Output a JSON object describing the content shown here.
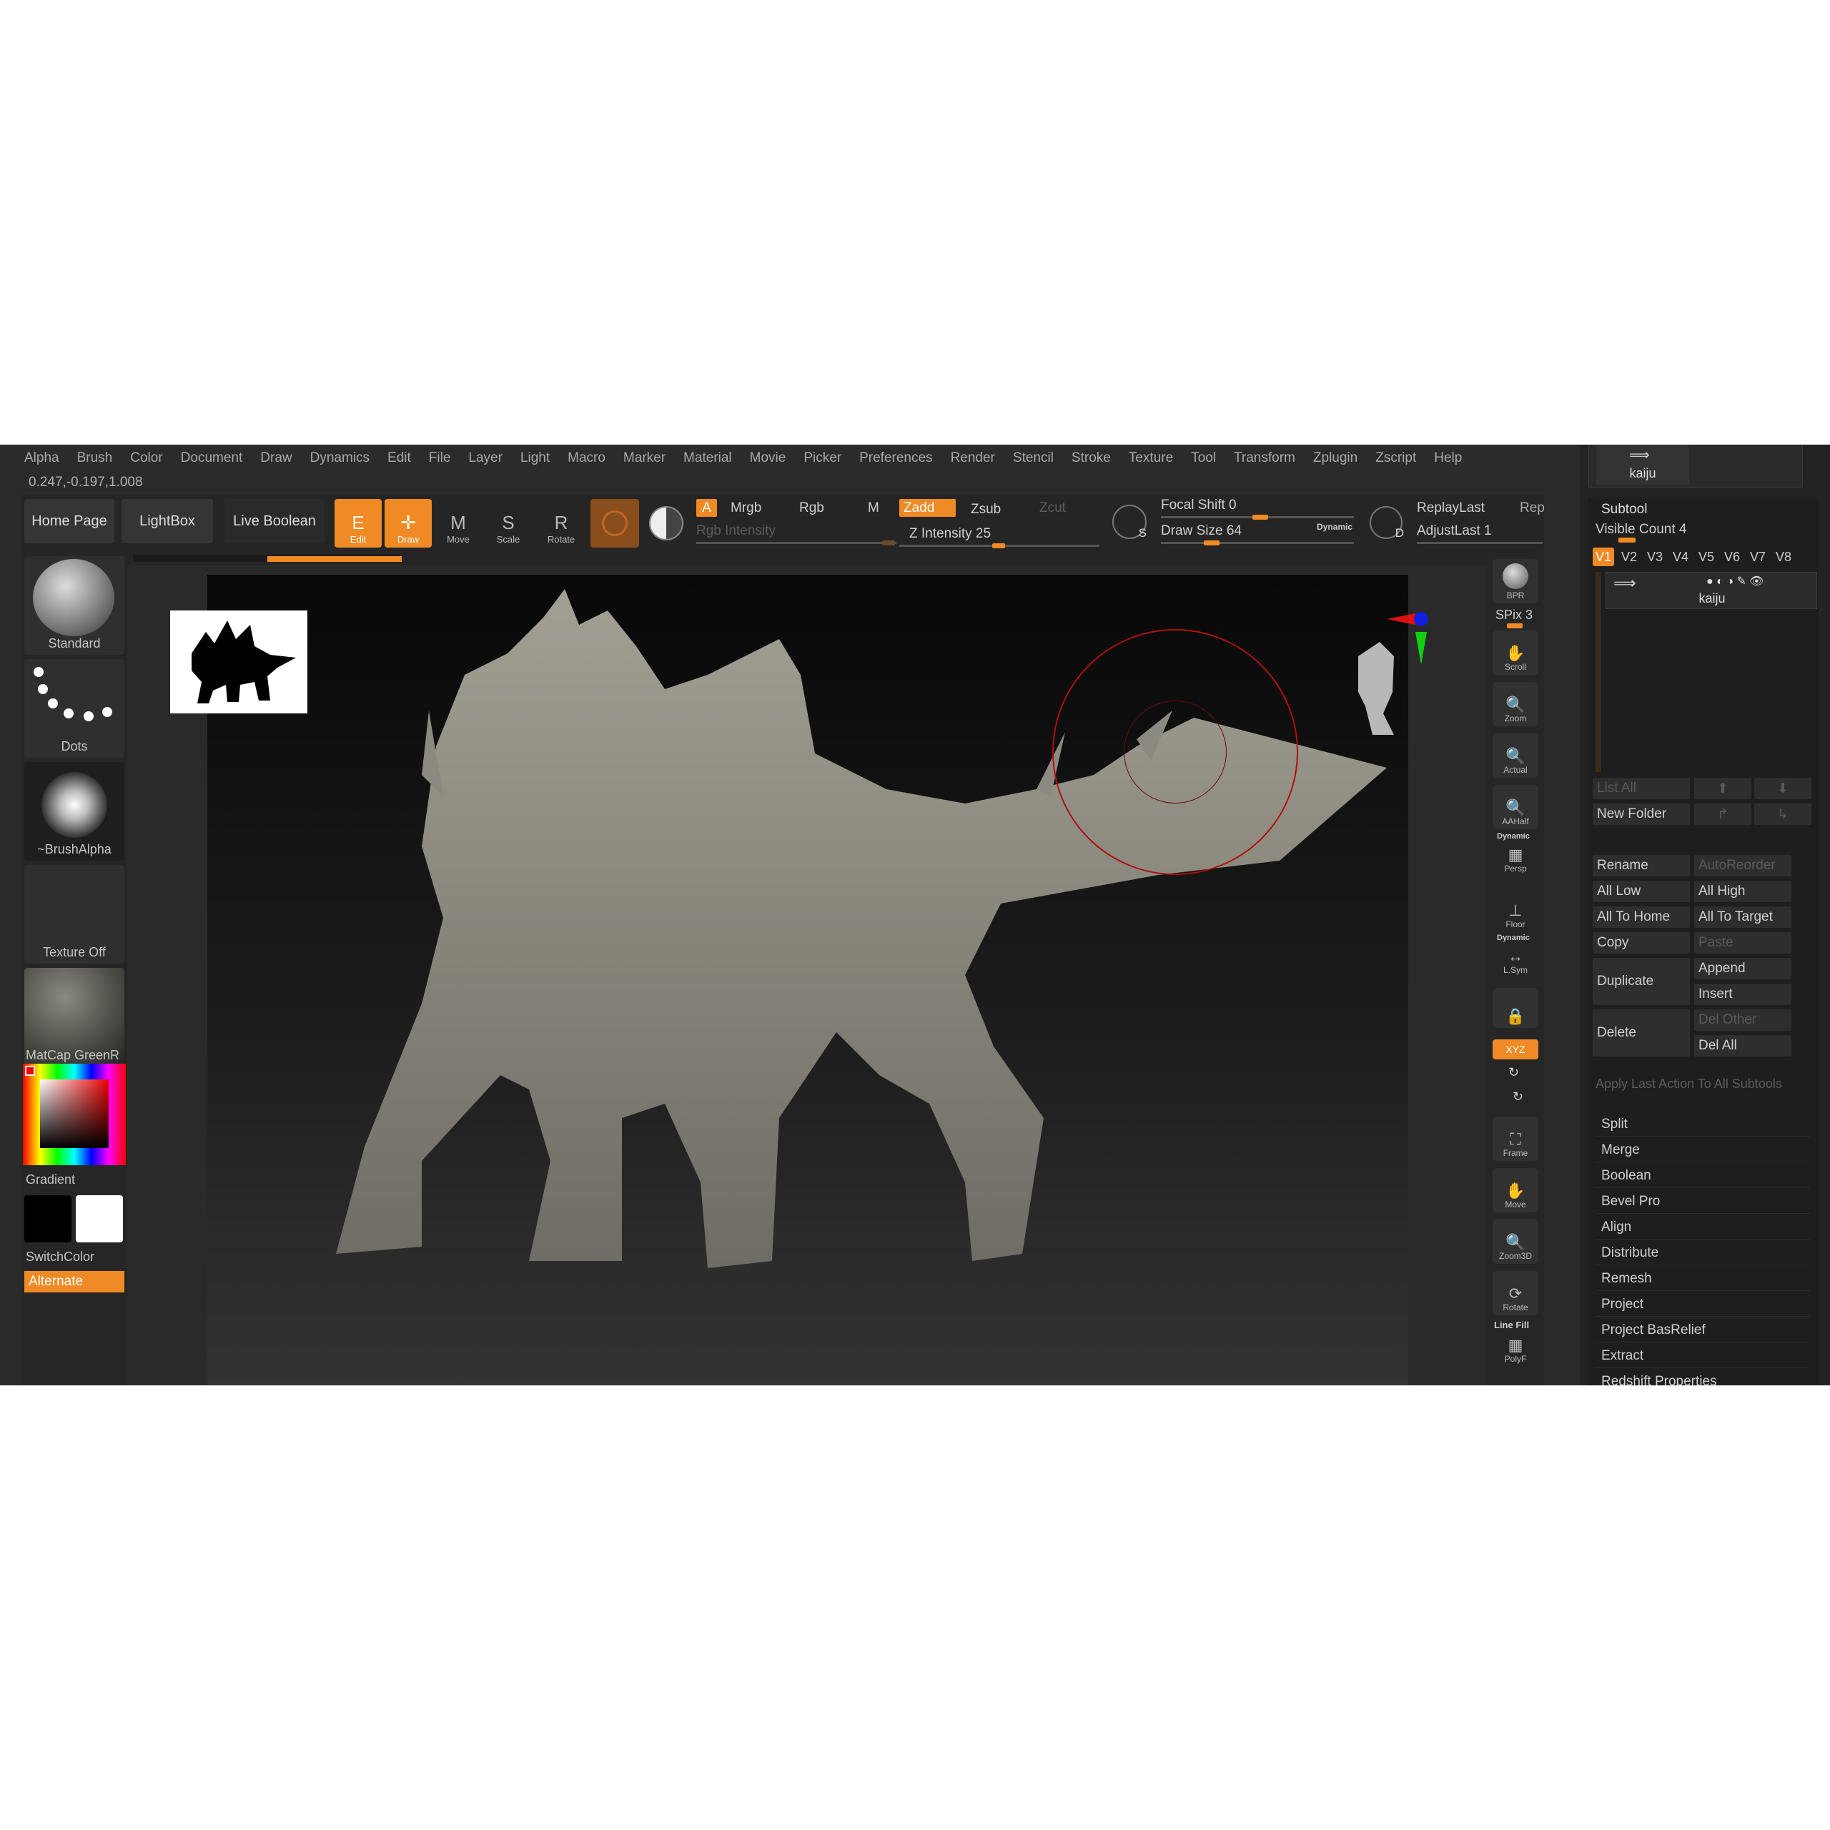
{
  "menu": [
    "Alpha",
    "Brush",
    "Color",
    "Document",
    "Draw",
    "Dynamics",
    "Edit",
    "File",
    "Layer",
    "Light",
    "Macro",
    "Marker",
    "Material",
    "Movie",
    "Picker",
    "Preferences",
    "Render",
    "Stencil",
    "Stroke",
    "Texture",
    "Tool",
    "Transform",
    "Zplugin",
    "Zscript",
    "Help"
  ],
  "coords": "0.247,-0.197,1.008",
  "top_buttons": {
    "home": "Home Page",
    "lightbox": "LightBox",
    "live_boolean": "Live Boolean"
  },
  "tools": {
    "edit": "Edit",
    "draw": "Draw",
    "move": "Move",
    "scale": "Scale",
    "rotate": "Rotate"
  },
  "tool_icons": {
    "edit": "E",
    "draw": "✛",
    "move": "M",
    "scale": "S",
    "rotate": "R"
  },
  "color_modes": {
    "a": "A",
    "mrgb": "Mrgb",
    "rgb": "Rgb",
    "m": "M",
    "rgb_intensity": "Rgb Intensity"
  },
  "z_modes": {
    "zadd": "Zadd",
    "zsub": "Zsub",
    "zcut": "Zcut",
    "z_intensity": "Z Intensity 25"
  },
  "focal_shift": "Focal Shift 0",
  "draw_size": "Draw Size 64",
  "dynamic": "Dynamic",
  "s_label": "S",
  "d_label": "D",
  "replay_last": "ReplayLast",
  "adjust_last": "AdjustLast 1",
  "rep": "Rep",
  "left_panel": {
    "brush": "Standard",
    "stroke": "Dots",
    "alpha": "~BrushAlpha",
    "texture": "Texture Off",
    "material": "MatCap GreenR",
    "gradient": "Gradient",
    "switch_color": "SwitchColor",
    "alternate": "Alternate"
  },
  "right_bar": {
    "bpr": "BPR",
    "spix": "SPix 3",
    "scroll": "Scroll",
    "zoom": "Zoom",
    "actual": "Actual",
    "aahalf": "AAHalf",
    "dynamic": "Dynamic",
    "persp": "Persp",
    "floor": "Floor",
    "dynamic2": "Dynamic",
    "lsym": "L.Sym",
    "xyz": "XYZ",
    "frame": "Frame",
    "move": "Move",
    "zoom3d": "Zoom3D",
    "rotate": "Rotate",
    "line_fill": "Line Fill",
    "polyf": "PolyF"
  },
  "right_panel": {
    "tool_name": "kaiju",
    "subtool_title": "Subtool",
    "visible_count": "Visible Count 4",
    "tabs": [
      "V1",
      "V2",
      "V3",
      "V4",
      "V5",
      "V6",
      "V7",
      "V8"
    ],
    "subtool_name": "kaiju",
    "list_all": "List All",
    "new_folder": "New Folder",
    "rename": "Rename",
    "auto_reorder": "AutoReorder",
    "all_low": "All Low",
    "all_high": "All High",
    "all_to_home": "All To Home",
    "all_to_target": "All To Target",
    "copy": "Copy",
    "paste": "Paste",
    "duplicate": "Duplicate",
    "append": "Append",
    "insert": "Insert",
    "delete": "Delete",
    "del_other": "Del Other",
    "del_all": "Del All",
    "apply_last": "Apply Last Action To All Subtools",
    "actions": [
      "Split",
      "Merge",
      "Boolean",
      "Bevel Pro",
      "Align",
      "Distribute",
      "Remesh",
      "Project",
      "Project BasRelief",
      "Extract",
      "Redshift Properties"
    ]
  },
  "colors": {
    "accent": "#f08a24",
    "background": "#2a2a2a",
    "panel": "#232323"
  }
}
